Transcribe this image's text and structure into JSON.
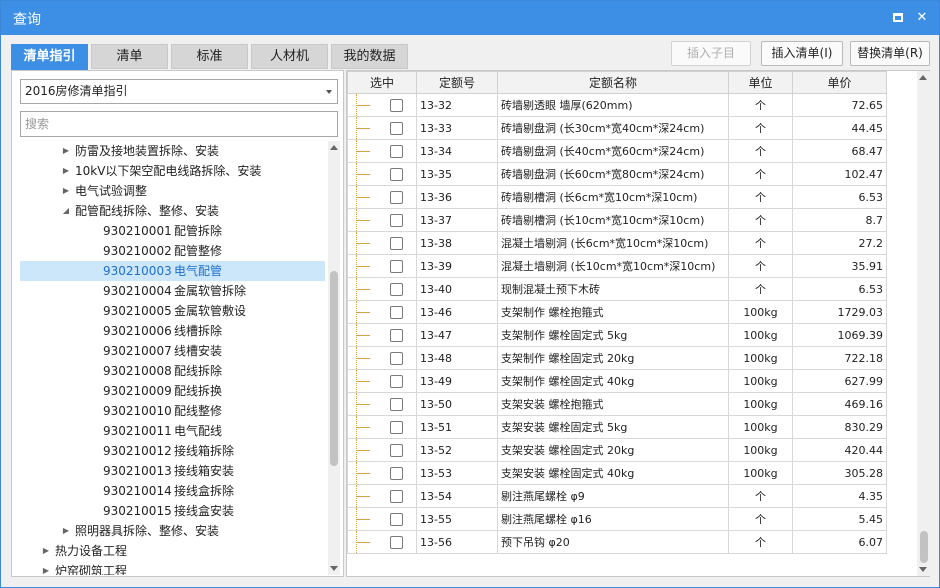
{
  "window": {
    "title": "查询",
    "maximize_label": "",
    "close_label": "✕"
  },
  "tabs": [
    {
      "label": "清单指引",
      "active": true
    },
    {
      "label": "清单",
      "active": false
    },
    {
      "label": "标准",
      "active": false
    },
    {
      "label": "人材机",
      "active": false
    },
    {
      "label": "我的数据",
      "active": false
    }
  ],
  "actions": {
    "insert_child": "插入子目",
    "insert_list": "插入清单(I)",
    "replace_list": "替换清单(R)"
  },
  "left": {
    "guide_select": "2016房修清单指引",
    "search_placeholder": "搜索",
    "tree": [
      {
        "kind": "node",
        "label": "防雷及接地装置拆除、安装",
        "expanded": false,
        "level": 2
      },
      {
        "kind": "node",
        "label": "10kV以下架空配电线路拆除、安装",
        "expanded": false,
        "level": 2
      },
      {
        "kind": "node",
        "label": "电气试验调整",
        "expanded": false,
        "level": 2
      },
      {
        "kind": "node",
        "label": "配管配线拆除、整修、安装",
        "expanded": true,
        "level": 2
      },
      {
        "kind": "leaf",
        "code": "930210001",
        "name": "配管拆除"
      },
      {
        "kind": "leaf",
        "code": "930210002",
        "name": "配管整修"
      },
      {
        "kind": "leaf",
        "code": "930210003",
        "name": "电气配管",
        "selected": true
      },
      {
        "kind": "leaf",
        "code": "930210004",
        "name": "金属软管拆除"
      },
      {
        "kind": "leaf",
        "code": "930210005",
        "name": "金属软管敷设"
      },
      {
        "kind": "leaf",
        "code": "930210006",
        "name": "线槽拆除"
      },
      {
        "kind": "leaf",
        "code": "930210007",
        "name": "线槽安装"
      },
      {
        "kind": "leaf",
        "code": "930210008",
        "name": "配线拆除"
      },
      {
        "kind": "leaf",
        "code": "930210009",
        "name": "配线拆换"
      },
      {
        "kind": "leaf",
        "code": "930210010",
        "name": "配线整修"
      },
      {
        "kind": "leaf",
        "code": "930210011",
        "name": "电气配线"
      },
      {
        "kind": "leaf",
        "code": "930210012",
        "name": "接线箱拆除"
      },
      {
        "kind": "leaf",
        "code": "930210013",
        "name": "接线箱安装"
      },
      {
        "kind": "leaf",
        "code": "930210014",
        "name": "接线盒拆除"
      },
      {
        "kind": "leaf",
        "code": "930210015",
        "name": "接线盒安装"
      },
      {
        "kind": "node",
        "label": "照明器具拆除、整修、安装",
        "expanded": false,
        "level": 2
      },
      {
        "kind": "node",
        "label": "热力设备工程",
        "expanded": false,
        "level": 1
      },
      {
        "kind": "node",
        "label": "炉窑砌筑工程",
        "expanded": false,
        "level": 1
      }
    ]
  },
  "table": {
    "columns": [
      "选中",
      "定额号",
      "定额名称",
      "单位",
      "单价"
    ],
    "rows": [
      {
        "code": "13-32",
        "name": "砖墙剔透眼 墙厚(620mm)",
        "unit": "个",
        "price": "72.65"
      },
      {
        "code": "13-33",
        "name": "砖墙剔盘洞 (长30cm*宽40cm*深24cm)",
        "unit": "个",
        "price": "44.45"
      },
      {
        "code": "13-34",
        "name": "砖墙剔盘洞 (长40cm*宽60cm*深24cm)",
        "unit": "个",
        "price": "68.47"
      },
      {
        "code": "13-35",
        "name": "砖墙剔盘洞 (长60cm*宽80cm*深24cm)",
        "unit": "个",
        "price": "102.47"
      },
      {
        "code": "13-36",
        "name": "砖墙剔槽洞 (长6cm*宽10cm*深10cm)",
        "unit": "个",
        "price": "6.53"
      },
      {
        "code": "13-37",
        "name": "砖墙剔槽洞 (长10cm*宽10cm*深10cm)",
        "unit": "个",
        "price": "8.7"
      },
      {
        "code": "13-38",
        "name": "混凝土墙剔洞 (长6cm*宽10cm*深10cm)",
        "unit": "个",
        "price": "27.2"
      },
      {
        "code": "13-39",
        "name": "混凝土墙剔洞 (长10cm*宽10cm*深10cm)",
        "unit": "个",
        "price": "35.91"
      },
      {
        "code": "13-40",
        "name": "现制混凝土预下木砖",
        "unit": "个",
        "price": "6.53"
      },
      {
        "code": "13-46",
        "name": "支架制作 螺栓抱箍式",
        "unit": "100kg",
        "price": "1729.03"
      },
      {
        "code": "13-47",
        "name": "支架制作 螺栓固定式 5kg",
        "unit": "100kg",
        "price": "1069.39"
      },
      {
        "code": "13-48",
        "name": "支架制作 螺栓固定式 20kg",
        "unit": "100kg",
        "price": "722.18"
      },
      {
        "code": "13-49",
        "name": "支架制作 螺栓固定式 40kg",
        "unit": "100kg",
        "price": "627.99"
      },
      {
        "code": "13-50",
        "name": "支架安装 螺栓抱箍式",
        "unit": "100kg",
        "price": "469.16"
      },
      {
        "code": "13-51",
        "name": "支架安装 螺栓固定式 5kg",
        "unit": "100kg",
        "price": "830.29"
      },
      {
        "code": "13-52",
        "name": "支架安装 螺栓固定式 20kg",
        "unit": "100kg",
        "price": "420.44"
      },
      {
        "code": "13-53",
        "name": "支架安装 螺栓固定式 40kg",
        "unit": "100kg",
        "price": "305.28"
      },
      {
        "code": "13-54",
        "name": "剔注燕尾螺栓 φ9",
        "unit": "个",
        "price": "4.35"
      },
      {
        "code": "13-55",
        "name": "剔注燕尾螺栓 φ16",
        "unit": "个",
        "price": "5.45"
      },
      {
        "code": "13-56",
        "name": "预下吊钩 φ20",
        "unit": "个",
        "price": "6.07"
      }
    ]
  },
  "colors": {
    "accent": "#3d8fe6",
    "selected_bg": "#cce6fa",
    "selected_text": "#1c6fd0",
    "tree_line": "#d4a53c"
  }
}
